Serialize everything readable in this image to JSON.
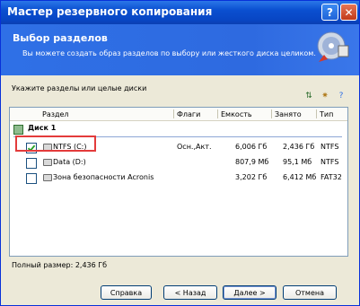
{
  "window": {
    "title": "Мастер резервного копирования",
    "help_glyph": "?",
    "close_glyph": "✕"
  },
  "header": {
    "title": "Выбор разделов",
    "subtitle": "Вы можете создать образ разделов по выбору или жесткого диска целиком."
  },
  "prompt": "Укажите разделы или целые диски",
  "toolbar_icons": [
    "sort-icon",
    "new-icon",
    "help-icon"
  ],
  "table": {
    "columns": [
      "Раздел",
      "Флаги",
      "Емкость",
      "Занято",
      "Тип"
    ],
    "group": "Диск 1",
    "rows": [
      {
        "name": "NTFS (C:)",
        "flags": "Осн.,Акт.",
        "capacity": "6,006 Гб",
        "used": "2,436 Гб",
        "type": "NTFS",
        "checked": true
      },
      {
        "name": "Data (D:)",
        "flags": "",
        "capacity": "807,9 Мб",
        "used": "95,1 Мб",
        "type": "NTFS",
        "checked": false
      },
      {
        "name": "Зона безопасности Acronis",
        "flags": "",
        "capacity": "3,202 Гб",
        "used": "6,412 Мб",
        "type": "FAT32",
        "checked": false
      }
    ]
  },
  "total_label": "Полный размер: 2,436 Гб",
  "buttons": {
    "help": "Справка",
    "back": "< Назад",
    "next": "Далее >",
    "cancel": "Отмена"
  },
  "colors": {
    "titlebar": "#0a4fd0",
    "header": "#2f70e6",
    "highlight": "#e33b3b",
    "group_check": "#8fbc8f"
  }
}
